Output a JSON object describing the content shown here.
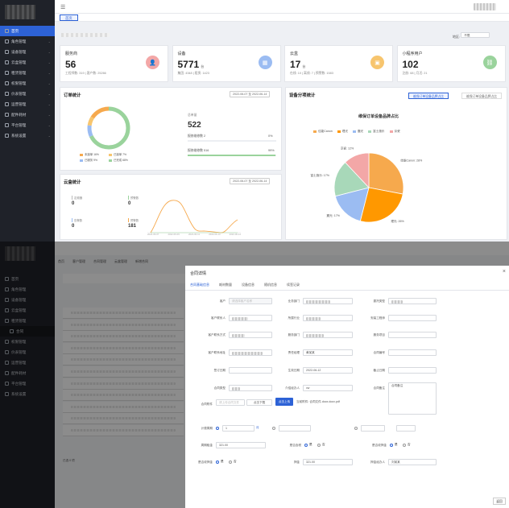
{
  "sidebar_top": {
    "items": [
      {
        "label": "首页",
        "active": true
      },
      {
        "label": "角色管理"
      },
      {
        "label": "设备管理"
      },
      {
        "label": "云盒管理"
      },
      {
        "label": "租赁管理"
      },
      {
        "label": "权限管理"
      },
      {
        "label": "价表管理"
      },
      {
        "label": "运营管理"
      },
      {
        "label": "配件耗材"
      },
      {
        "label": "平台管理"
      },
      {
        "label": "系统设置"
      }
    ]
  },
  "tabs": {
    "home": "首页"
  },
  "stats": [
    {
      "title": "服务商",
      "value": "56",
      "unit": "",
      "sub": "工程师数: 319 | 客户数: 25266",
      "color": "#f3a7a7",
      "icon": "user-icon"
    },
    {
      "title": "设备",
      "value": "5771",
      "unit": "台",
      "sub": "集团: 4348 | 租赁: 1423",
      "color": "#9bbcf2",
      "icon": "calendar-icon"
    },
    {
      "title": "云盒",
      "value": "17",
      "unit": "台",
      "sub": "在线: 10 | 离线: 7 | 预警数: 1583",
      "color": "#f7c56e",
      "icon": "box-icon"
    },
    {
      "title": "小程序用户",
      "value": "102",
      "unit": "",
      "sub": "注册: 68 | 月活: 21",
      "color": "#9ad39c",
      "icon": "link-icon"
    }
  ],
  "region": {
    "label": "地区:",
    "value": "不限"
  },
  "order_stats": {
    "title": "订单统计",
    "date_range": "2022-06-07 至 2022-06-14",
    "total_label": "总单量",
    "total_value": "522",
    "rows": [
      {
        "label": "报修维修数 2",
        "pct": "0%",
        "fill": 0.0
      },
      {
        "label": "报修维修数 516",
        "pct": "99%",
        "fill": 0.99
      }
    ],
    "legend": [
      {
        "label": "未接单 16%",
        "color": "#f6a94d"
      },
      {
        "label": "已接单 7%",
        "color": "#f7c56e"
      },
      {
        "label": "已服务 9%",
        "color": "#9bbcf2"
      },
      {
        "label": "已完成 68%",
        "color": "#9ad39c"
      }
    ]
  },
  "cloud_stats": {
    "title": "云盒统计",
    "date_range": "2022-06-07 至 2022-06-14",
    "items": [
      {
        "label": "定频器",
        "value": "0"
      },
      {
        "label": "预警数",
        "value": "0"
      },
      {
        "label": "告警数",
        "value": "0"
      },
      {
        "label": "预警数",
        "value": "181"
      }
    ],
    "x_labels": [
      "2022-06-07",
      "2022-06-09",
      "2022-06-11",
      "2022-06-13",
      "2022-06-14"
    ]
  },
  "device_stats": {
    "title": "设备分项统计",
    "tab_active": "维保订单设备品牌占比",
    "tab_inactive": "维保订单设备品牌占比",
    "chart_title": "维保订单设备品牌占比",
    "legend": [
      "佳能Canon",
      "理光",
      "震光",
      "富士施乐",
      "京瓷"
    ]
  },
  "chart_data": {
    "type": "pie",
    "title": "维保订单设备品牌占比",
    "labels": [
      "佳能Canon",
      "理光",
      "震光",
      "富士施乐",
      "京瓷"
    ],
    "values": [
      28,
      26,
      17,
      17,
      12
    ],
    "colors": [
      "#f6a94d",
      "#ff9800",
      "#9bbcf2",
      "#a8d8b9",
      "#f3a7a7"
    ]
  },
  "drawer": {
    "title": "合同详情",
    "tabs": [
      "合同基础信息",
      "耗材数量",
      "设备信息",
      "随机信息",
      "续签记录"
    ],
    "fields": {
      "customer": "客户",
      "customer_placeholder": "请选择客户名称",
      "dept": "业务部门",
      "contract_type": "委托类型",
      "contact": "客户联系人",
      "industry": "所属行业",
      "engineer": "安装工程师",
      "contact_method": "客户联系方式",
      "dept2": "服务部门",
      "project": "服务项目",
      "address": "客户联系地址",
      "manager": "责任经理",
      "manager_value": "黄某某",
      "contract_no": "合同编号",
      "sign_date": "签订日期",
      "effective_date": "生效日期",
      "effective_value": "2022-06-12",
      "expire_date": "截止日期",
      "contract_kind": "合同类型",
      "introducer": "介绍经办人",
      "introducer_value": "vw",
      "note": "合同备注",
      "note_value": "合同备注",
      "attachment": "合同附件",
      "attachment_placeholder": "请上传合同文件",
      "download": "点击下载",
      "upload": "点击上传",
      "file_label": "当前附件:",
      "file_name": "合同文件.docx.docx.pdf",
      "billing": "计费周期",
      "billing_value": "1",
      "month": "月",
      "free_period": "免租期",
      "rent": "周期租金",
      "rent_value": "321.00",
      "tax": "是否含税",
      "tax_yes": "是",
      "tax_no": "否",
      "deposit_yes": "是",
      "deposit_no": "否",
      "deposit_label": "是否收押金",
      "deposit": "押金",
      "deposit_value": "321.00",
      "deposit_handler": "押金经办人",
      "deposit_handler_value": "刘某某",
      "close": "×",
      "back": "返回"
    }
  },
  "bg_sidebar": [
    "首页",
    "角色管理",
    "设备管理",
    "云盒管理",
    "租赁管理",
    "合同",
    "权限管理",
    "价表管理",
    "运营管理",
    "配件耗材",
    "平台管理",
    "系统设置"
  ],
  "bg_tabs": [
    "首页",
    "客户管理",
    "合同管理",
    "云盒管理",
    "新增合同"
  ],
  "bg_footer": "已选 0 项"
}
